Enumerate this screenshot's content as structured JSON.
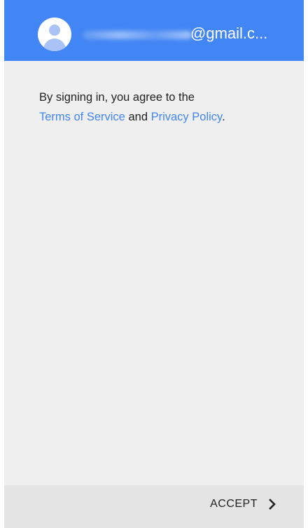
{
  "header": {
    "email_domain": "@gmail.c...",
    "icon": "account-circle-icon",
    "color": "#4285f4"
  },
  "consent": {
    "prefix": "By signing in, you agree to the",
    "terms_link": "Terms of Service",
    "conjunction": "and",
    "privacy_link": "Privacy Policy",
    "suffix": "."
  },
  "footer": {
    "accept_label": "ACCEPT",
    "icon": "chevron-right-icon"
  }
}
